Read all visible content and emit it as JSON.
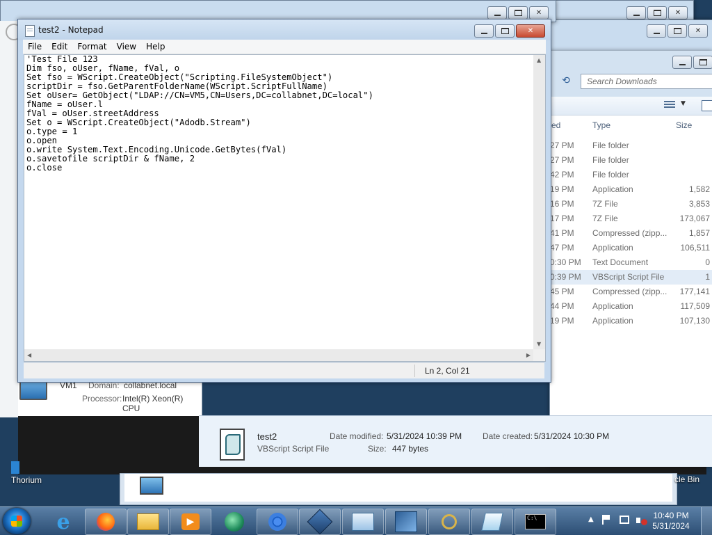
{
  "notepad": {
    "title": "test2 - Notepad",
    "menu": [
      "File",
      "Edit",
      "Format",
      "View",
      "Help"
    ],
    "content": "'Test File 123\nDim fso, oUser, fName, fVal, o\nSet fso = WScript.CreateObject(\"Scripting.FileSystemObject\")\nscriptDir = fso.GetParentFolderName(WScript.ScriptFullName)\nSet oUser= GetObject(\"LDAP://CN=VM5,CN=Users,DC=collabnet,DC=local\")\nfName = oUser.l\nfVal = oUser.streetAddress\nSet o = WScript.CreateObject(\"Adodb.Stream\")\no.type = 1\no.open\no.write System.Text.Encoding.Unicode.GetBytes(fVal)\no.savetofile scriptDir & fName, 2\no.close",
    "status_position": "Ln 2, Col 21"
  },
  "explorer": {
    "search_placeholder": "Search Downloads",
    "columns": {
      "modified": "ed",
      "type": "Type",
      "size": "Size"
    },
    "rows": [
      {
        "time": "27 PM",
        "type": "File folder",
        "size": ""
      },
      {
        "time": "27 PM",
        "type": "File folder",
        "size": ""
      },
      {
        "time": "42 PM",
        "type": "File folder",
        "size": ""
      },
      {
        "time": "19 PM",
        "type": "Application",
        "size": "1,582"
      },
      {
        "time": "16 PM",
        "type": "7Z File",
        "size": "3,853"
      },
      {
        "time": "17 PM",
        "type": "7Z File",
        "size": "173,067"
      },
      {
        "time": "41 PM",
        "type": "Compressed (zipp...",
        "size": "1,857"
      },
      {
        "time": "47 PM",
        "type": "Application",
        "size": "106,511"
      },
      {
        "time": "0:30 PM",
        "type": "Text Document",
        "size": "0"
      },
      {
        "time": "0:39 PM",
        "type": "VBScript Script File",
        "size": "1"
      },
      {
        "time": "45 PM",
        "type": "Compressed (zipp...",
        "size": "177,141"
      },
      {
        "time": "44 PM",
        "type": "Application",
        "size": "117,509"
      },
      {
        "time": "19 PM",
        "type": "Application",
        "size": "107,130"
      }
    ],
    "details": {
      "name": "test2",
      "file_type": "VBScript Script File",
      "date_modified_label": "Date modified:",
      "date_modified": "5/31/2024 10:39 PM",
      "date_created_label": "Date created:",
      "date_created": "5/31/2024 10:30 PM",
      "size_label": "Size:",
      "size": "447 bytes"
    }
  },
  "system_window": {
    "computer_name": "VM1",
    "domain_label": "Domain:",
    "domain": "collabnet.local",
    "processor_label": "Processor:",
    "processor": "Intel(R) Xeon(R) CPU"
  },
  "desktop": {
    "left_icon_label": "Thorium",
    "right_icon_label": "cle Bin"
  },
  "taskbar": {
    "apps": [
      "internet-explorer",
      "firefox",
      "file-explorer",
      "media-player",
      "chromium-like",
      "chrome",
      "virtualbox",
      "control-panel",
      "network-tool",
      "search-tool",
      "notepad-like",
      "command-prompt"
    ],
    "clock_time": "10:40 PM",
    "clock_date": "5/31/2024"
  },
  "colors": {
    "desktop": "#1f3f5f",
    "close_button": "#c74a31",
    "taskbar": "#2c4e74"
  }
}
